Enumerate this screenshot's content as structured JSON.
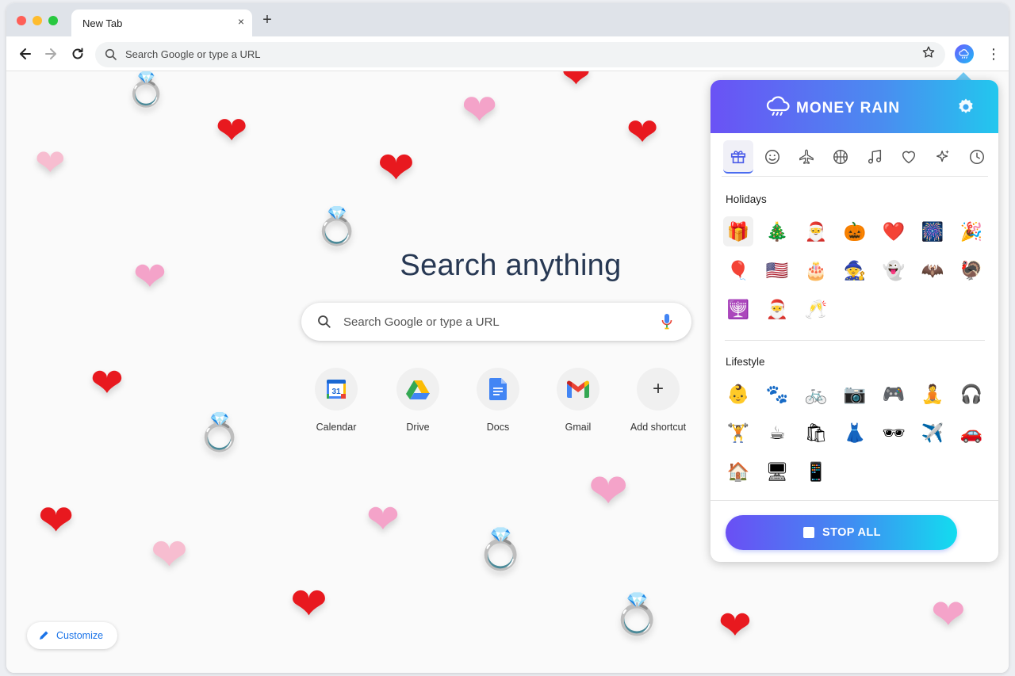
{
  "browser": {
    "tab_title": "New Tab",
    "tab_close": "×",
    "new_tab": "+",
    "omnibox_placeholder": "Search Google or type a URL",
    "menu": "⋮"
  },
  "newtab": {
    "title": "Search anything",
    "search_placeholder": "Search Google or type a URL",
    "shortcuts": [
      {
        "label": "Calendar",
        "icon": "calendar-icon"
      },
      {
        "label": "Drive",
        "icon": "drive-icon"
      },
      {
        "label": "Docs",
        "icon": "docs-icon"
      },
      {
        "label": "Gmail",
        "icon": "gmail-icon"
      },
      {
        "label": "Add shortcut",
        "icon": "plus-icon",
        "glyph": "+"
      }
    ],
    "calendar_day": "31",
    "customize_label": "Customize"
  },
  "rain": {
    "hearts": "❤",
    "ring": "💍"
  },
  "popup": {
    "title": "MONEY RAIN",
    "category_icons": [
      "gift-icon",
      "smiley-icon",
      "plane-icon",
      "basketball-icon",
      "music-note-icon",
      "heart-outline-icon",
      "sparkle-icon",
      "clock-icon"
    ],
    "sections": [
      {
        "label": "Holidays",
        "emojis": [
          "🎁",
          "🎄",
          "🎅",
          "🎃",
          "❤️",
          "🎆",
          "🎉",
          "🎈",
          "🇺🇸",
          "🎂",
          "🧙",
          "👻",
          "🦇",
          "🦃",
          "🕎",
          "🎅",
          "🥂"
        ]
      },
      {
        "label": "Lifestyle",
        "emojis": [
          "👶",
          "🐾",
          "🚲",
          "📷",
          "🎮",
          "🧘",
          "🎧",
          "🏋",
          "☕",
          "🛍",
          "👗",
          "🕶",
          "✈️",
          "🚗",
          "🏠",
          "🖥",
          "📱"
        ]
      }
    ],
    "stop_label": "STOP ALL"
  },
  "colors": {
    "accent_start": "#6a52f5",
    "accent_end": "#22c7ee",
    "heart_red": "#e8191f",
    "heart_pink": "#f4a3c9",
    "link_blue": "#1a73e8"
  }
}
